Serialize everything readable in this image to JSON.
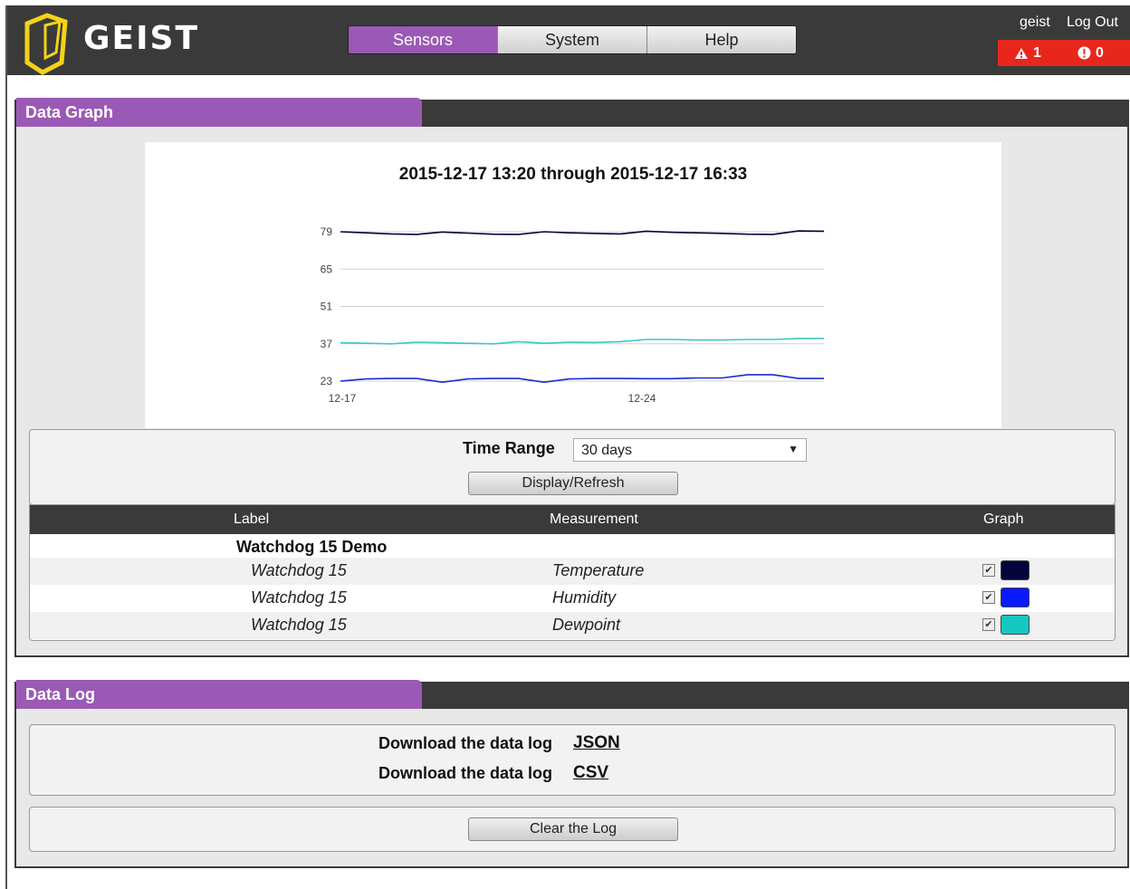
{
  "header": {
    "logo_text": "GEIST",
    "tabs": [
      {
        "label": "Sensors",
        "active": true
      },
      {
        "label": "System",
        "active": false
      },
      {
        "label": "Help",
        "active": false
      }
    ],
    "user": "geist",
    "logout_label": "Log Out",
    "alarm_warning_count": "1",
    "alarm_critical_count": "0"
  },
  "graph_panel": {
    "title": "Data Graph",
    "chart_title": "2015-12-17 13:20 through 2015-12-17 16:33",
    "time_range_label": "Time Range",
    "time_range_value": "30 days",
    "refresh_label": "Display/Refresh",
    "table": {
      "headers": [
        "Label",
        "Measurement",
        "Graph"
      ],
      "group": "Watchdog 15 Demo",
      "rows": [
        {
          "label": "Watchdog 15",
          "measurement": "Temperature",
          "checked": true,
          "color": "#04043a"
        },
        {
          "label": "Watchdog 15",
          "measurement": "Humidity",
          "checked": true,
          "color": "#0a1aff"
        },
        {
          "label": "Watchdog 15",
          "measurement": "Dewpoint",
          "checked": true,
          "color": "#14c8c0"
        }
      ]
    }
  },
  "chart_data": {
    "type": "line",
    "title": "2015-12-17 13:20 through 2015-12-17 16:33",
    "x_ticks": [
      "12-17",
      "12-24"
    ],
    "y_ticks": [
      23,
      37,
      51,
      65,
      79
    ],
    "ylim": [
      23,
      79
    ],
    "grid": true,
    "series": [
      {
        "name": "Temperature",
        "color": "#04043a",
        "values": [
          79.0,
          78.6,
          78.2,
          78.0,
          78.9,
          78.5,
          78.1,
          78.0,
          79.0,
          78.6,
          78.4,
          78.2,
          79.2,
          78.8,
          78.6,
          78.4,
          78.1,
          78.0,
          79.3,
          79.2
        ]
      },
      {
        "name": "Humidity",
        "color": "#1a2ad0",
        "values": [
          23.0,
          23.8,
          24.0,
          24.0,
          22.6,
          23.8,
          24.0,
          24.0,
          22.6,
          23.8,
          24.0,
          24.0,
          23.9,
          23.9,
          24.2,
          24.2,
          25.4,
          25.4,
          24.0,
          24.0
        ]
      },
      {
        "name": "Dewpoint",
        "color": "#3cc8c0",
        "values": [
          37.4,
          37.2,
          37.0,
          37.6,
          37.4,
          37.2,
          37.0,
          37.8,
          37.2,
          37.6,
          37.5,
          37.8,
          38.6,
          38.6,
          38.4,
          38.4,
          38.6,
          38.6,
          39.0,
          39.0
        ]
      }
    ]
  },
  "log_panel": {
    "title": "Data Log",
    "download_label": "Download the data log",
    "json_link": "JSON",
    "csv_link": "CSV",
    "clear_label": "Clear the Log"
  }
}
